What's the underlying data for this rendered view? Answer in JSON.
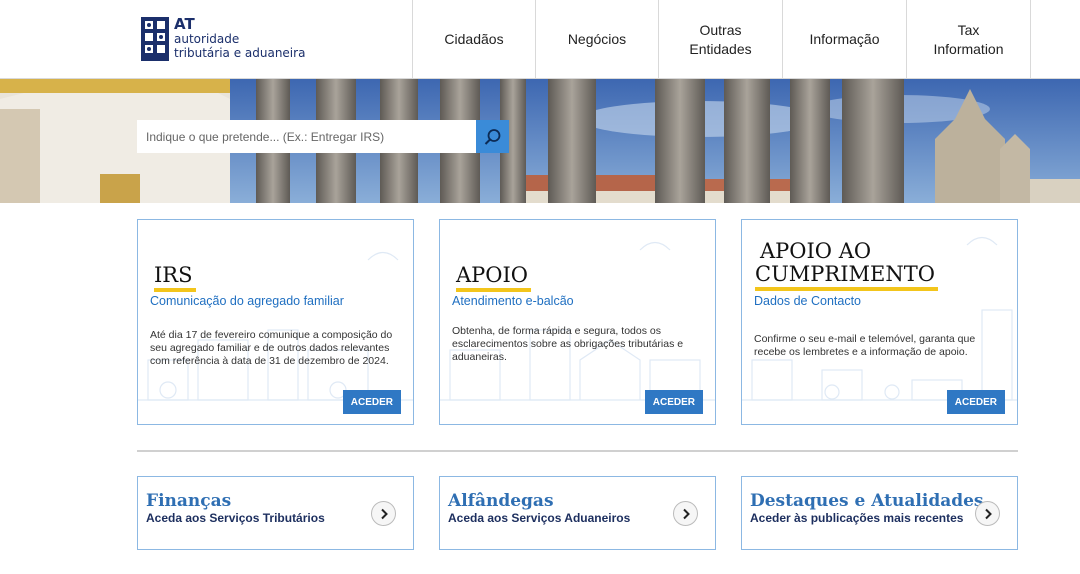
{
  "logo": {
    "abbr": "AT",
    "line1": "autoridade",
    "line2": "tributária e aduaneira"
  },
  "nav": [
    {
      "line1": "Cidadãos",
      "line2": ""
    },
    {
      "line1": "Negócios",
      "line2": ""
    },
    {
      "line1": "Outras",
      "line2": "Entidades"
    },
    {
      "line1": "Informação",
      "line2": ""
    },
    {
      "line1": "Tax",
      "line2": "Information"
    }
  ],
  "search": {
    "placeholder": "Indique o que pretende... (Ex.: Entregar IRS)",
    "icon": "search-icon"
  },
  "cards": [
    {
      "title_line1": "IRS",
      "title_line2": "",
      "subtitle": "Comunicação do agregado familiar",
      "text": "Até dia 17 de fevereiro comunique a composição do seu agregado familiar e de outros dados relevantes com referência à data de 31 de dezembro de 2024.",
      "button": "ACEDER"
    },
    {
      "title_line1": "APOIO",
      "title_line2": "",
      "subtitle": "Atendimento e-balcão",
      "text": "Obtenha, de forma rápida e segura, todos os esclarecimentos sobre as obrigações tributárias e aduaneiras.",
      "button": "ACEDER"
    },
    {
      "title_line1": "APOIO AO",
      "title_line2": "CUMPRIMENTO",
      "subtitle": "Dados de Contacto",
      "text": "Confirme o seu e-mail e telemóvel, garanta que recebe os lembretes e a informação de apoio.",
      "button": "ACEDER"
    }
  ],
  "links": [
    {
      "title": "Finanças",
      "subtitle": "Aceda aos Serviços Tributários"
    },
    {
      "title": "Alfândegas",
      "subtitle": "Aceda aos Serviços Aduaneiros"
    },
    {
      "title": "Destaques e Atualidades",
      "subtitle": "Aceder às publicações mais recentes"
    }
  ],
  "colors": {
    "accent_blue": "#2f78c4",
    "title_blue": "#2f6fb3",
    "underline_yellow": "#f3c51b",
    "logo_navy": "#1b2f6b"
  }
}
